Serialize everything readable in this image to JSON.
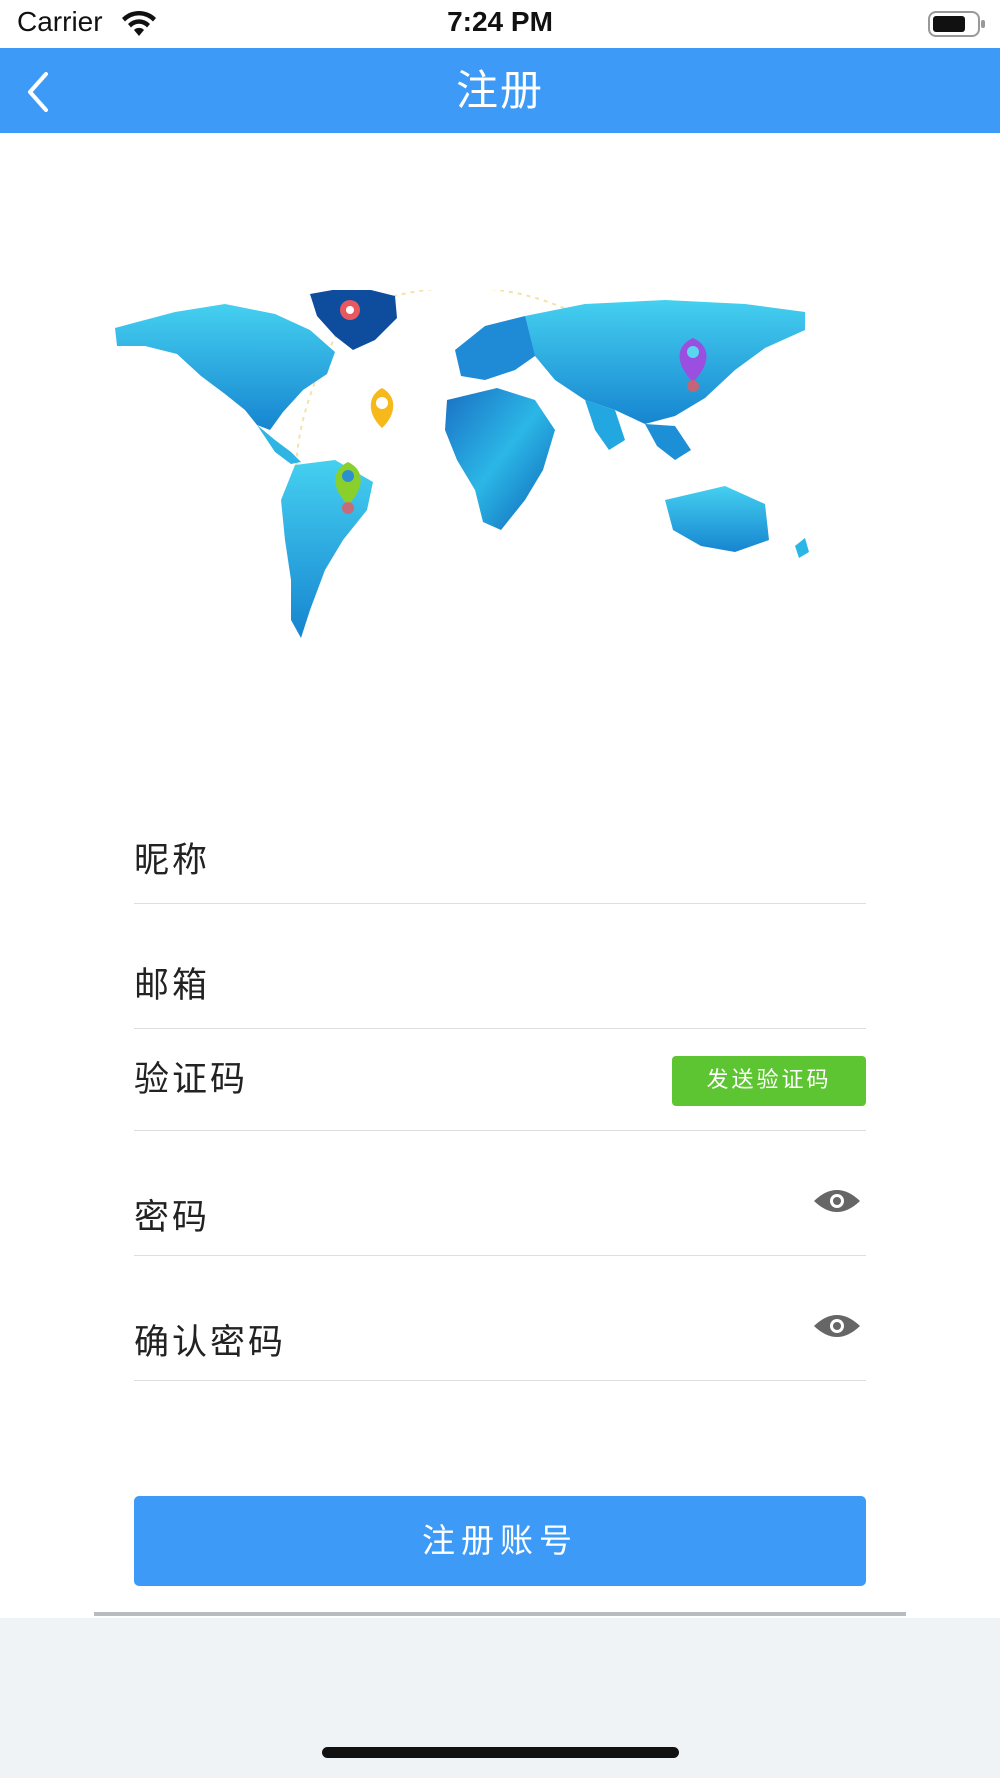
{
  "status_bar": {
    "carrier": "Carrier",
    "time": "7:24 PM",
    "icons": [
      "wifi-icon",
      "battery-icon"
    ]
  },
  "nav": {
    "title": "注册",
    "back_icon": "chevron-left-icon",
    "color": "#3d9bf7"
  },
  "illustration": {
    "name": "world-map-icon",
    "pins": [
      "red-pin",
      "yellow-pin",
      "green-pin",
      "purple-pin"
    ]
  },
  "form": {
    "nickname_placeholder": "昵称",
    "email_placeholder": "邮箱",
    "verify_code_placeholder": "验证码",
    "send_code_label": "发送验证码",
    "password_placeholder": "密码",
    "confirm_password_placeholder": "确认密码",
    "show_password_icon": "eye-icon"
  },
  "register_button_label": "注册账号",
  "colors": {
    "primary": "#3d9bf7",
    "send_code": "#5cc531",
    "bottom_bg": "#f0f3f6"
  }
}
